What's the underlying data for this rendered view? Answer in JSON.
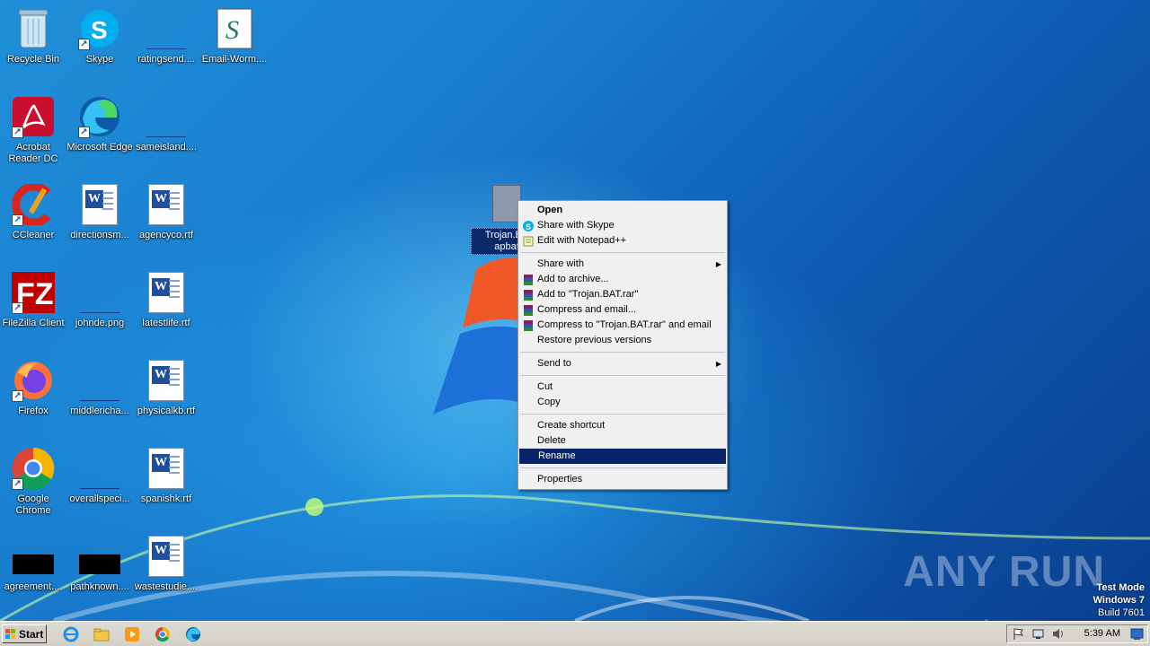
{
  "desktop": {
    "icons": [
      {
        "label": "Recycle Bin",
        "icon": "recycle-bin-icon"
      },
      {
        "label": "Skype",
        "icon": "skype-icon"
      },
      {
        "label": "ratingsend....",
        "icon": "blank-file-icon"
      },
      {
        "label": "Email-Worm....",
        "icon": "script-file-icon"
      },
      {
        "label": "Acrobat Reader DC",
        "icon": "acrobat-icon"
      },
      {
        "label": "Microsoft Edge",
        "icon": "edge-icon"
      },
      {
        "label": "sameisland....",
        "icon": "blank-file-icon"
      },
      {
        "label": "CCleaner",
        "icon": "ccleaner-icon"
      },
      {
        "label": "directionsm...",
        "icon": "word-doc-icon"
      },
      {
        "label": "agencyco.rtf",
        "icon": "word-doc-icon"
      },
      {
        "label": "FileZilla Client",
        "icon": "filezilla-icon"
      },
      {
        "label": "johnde.png",
        "icon": "blank-file-icon"
      },
      {
        "label": "latestlife.rtf",
        "icon": "word-doc-icon"
      },
      {
        "label": "Firefox",
        "icon": "firefox-icon"
      },
      {
        "label": "middlericha...",
        "icon": "blank-file-icon"
      },
      {
        "label": "physicalkb.rtf",
        "icon": "word-doc-icon"
      },
      {
        "label": "Google Chrome",
        "icon": "chrome-icon"
      },
      {
        "label": "overallspeci...",
        "icon": "blank-file-icon"
      },
      {
        "label": "spanishk.rtf",
        "icon": "word-doc-icon"
      },
      {
        "label": "agreement....",
        "icon": "black-file-icon"
      },
      {
        "label": "pathknown....",
        "icon": "black-file-icon"
      },
      {
        "label": "wastestudie....",
        "icon": "word-doc-icon"
      }
    ],
    "selected_file": {
      "label_line1": "Trojan.BA",
      "label_line2": "apbat"
    }
  },
  "context_menu": {
    "items": [
      {
        "label": "Open",
        "bold": true
      },
      {
        "label": "Share with Skype",
        "icon": "skype-icon"
      },
      {
        "label": "Edit with Notepad++",
        "icon": "notepadpp-icon"
      },
      {
        "label": "Share with",
        "submenu": true
      },
      {
        "label": "Add to archive...",
        "icon": "winrar-icon"
      },
      {
        "label": "Add to \"Trojan.BAT.rar\"",
        "icon": "winrar-icon"
      },
      {
        "label": "Compress and email...",
        "icon": "winrar-icon"
      },
      {
        "label": "Compress to \"Trojan.BAT.rar\" and email",
        "icon": "winrar-icon"
      },
      {
        "label": "Restore previous versions"
      },
      {
        "label": "Send to",
        "submenu": true
      },
      {
        "label": "Cut"
      },
      {
        "label": "Copy"
      },
      {
        "label": "Create shortcut"
      },
      {
        "label": "Delete"
      },
      {
        "label": "Rename",
        "highlighted": true
      },
      {
        "label": "Properties"
      }
    ]
  },
  "watermark": {
    "text": "ANY RUN"
  },
  "test_mode": {
    "line1": "Test Mode",
    "line2": "Windows 7",
    "line3": "Build 7601"
  },
  "taskbar": {
    "start_label": "Start",
    "quick_launch": [
      "internet-explorer-icon",
      "explorer-folder-icon",
      "media-player-icon",
      "chrome-icon",
      "edge-icon"
    ],
    "clock": "5:39 AM"
  },
  "colors": {
    "menu_highlight": "#0a246a",
    "desktop_blue": "#1a7fd0",
    "taskbar": "#d4d0c8"
  }
}
